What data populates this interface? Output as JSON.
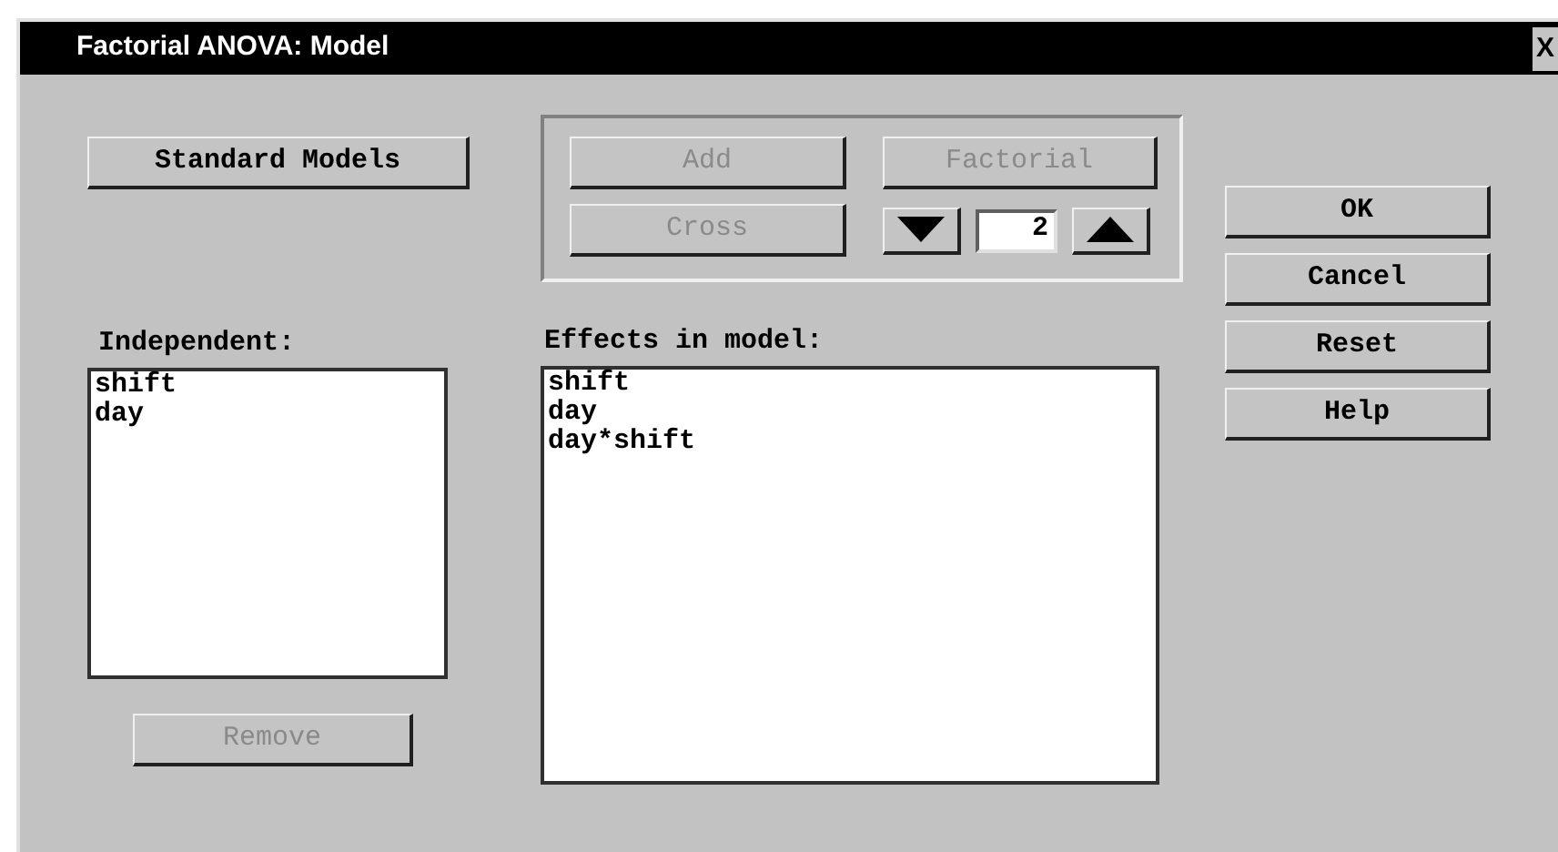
{
  "window": {
    "title": "Factorial ANOVA: Model",
    "close": "X"
  },
  "standard_models_button": {
    "label": "Standard Models",
    "disabled": false
  },
  "effect_buttons": [
    {
      "label": "Add",
      "disabled": true
    },
    {
      "label": "Factorial",
      "disabled": true
    },
    {
      "label": "Cross",
      "disabled": true
    }
  ],
  "order_spinner": {
    "value": "2"
  },
  "independent": {
    "label": "Independent:",
    "items": [
      "shift",
      "day"
    ]
  },
  "remove_button": {
    "label": "Remove",
    "disabled": true
  },
  "effects": {
    "label": "Effects in model:",
    "items": [
      "shift",
      "day",
      "day*shift"
    ]
  },
  "dialog_buttons": [
    {
      "label": "OK",
      "disabled": false
    },
    {
      "label": "Cancel",
      "disabled": false
    },
    {
      "label": "Reset",
      "disabled": false
    },
    {
      "label": "Help",
      "disabled": false
    }
  ]
}
